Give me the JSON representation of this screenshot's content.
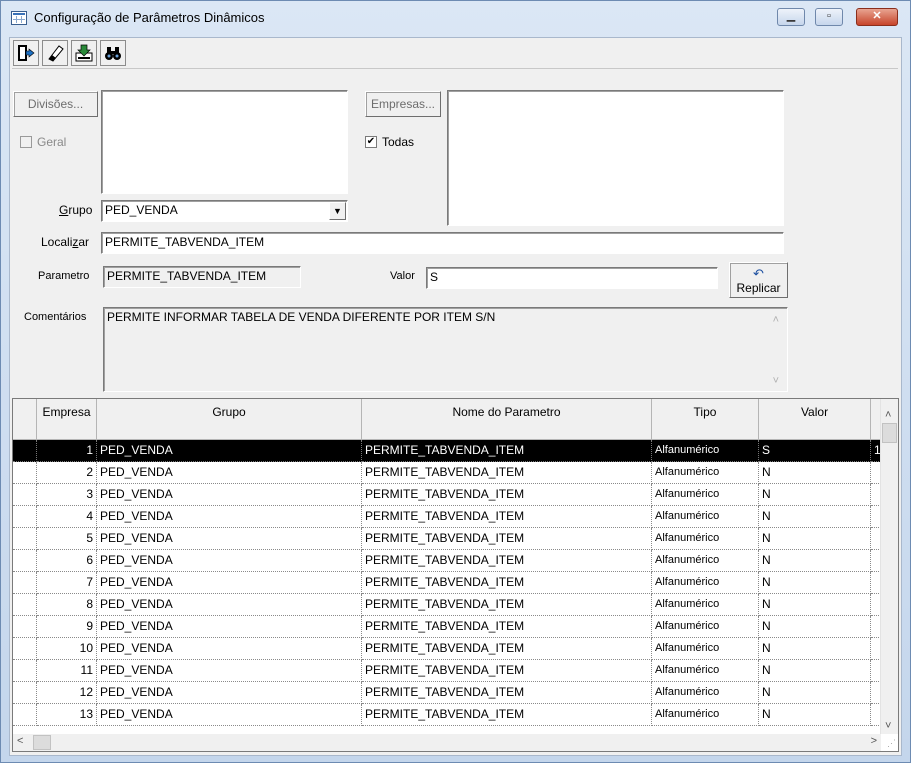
{
  "window": {
    "title": "Configuração de Parâmetros Dinâmicos"
  },
  "toolbar": {
    "buttons": [
      {
        "icon": "exit-door-icon"
      },
      {
        "icon": "eraser-icon"
      },
      {
        "icon": "save-download-icon"
      },
      {
        "icon": "binoculars-icon"
      }
    ]
  },
  "form": {
    "divisoes_label": "Divisões...",
    "geral_label": "Geral",
    "empresas_label": "Empresas...",
    "todas_label": "Todas",
    "todas_checked": "✔",
    "grupo_label": "Grupo",
    "grupo_value": "PED_VENDA",
    "localizar_label": "Localizar",
    "localizar_value": "PERMITE_TABVENDA_ITEM",
    "parametro_label": "Parametro",
    "parametro_value": "PERMITE_TABVENDA_ITEM",
    "valor_label": "Valor",
    "valor_value": "S",
    "replicar_label": "Replicar",
    "comentarios_label": "Comentários",
    "comentarios_value": "PERMITE INFORMAR TABELA DE VENDA DIFERENTE POR ITEM  S/N"
  },
  "grid": {
    "columns": [
      "Empresa",
      "Grupo",
      "Nome do Parametro",
      "Tipo",
      "Valor"
    ],
    "selected_row_extra": "1",
    "rows": [
      [
        "1",
        "PED_VENDA",
        "PERMITE_TABVENDA_ITEM",
        "Alfanumérico",
        "S"
      ],
      [
        "2",
        "PED_VENDA",
        "PERMITE_TABVENDA_ITEM",
        "Alfanumérico",
        "N"
      ],
      [
        "3",
        "PED_VENDA",
        "PERMITE_TABVENDA_ITEM",
        "Alfanumérico",
        "N"
      ],
      [
        "4",
        "PED_VENDA",
        "PERMITE_TABVENDA_ITEM",
        "Alfanumérico",
        "N"
      ],
      [
        "5",
        "PED_VENDA",
        "PERMITE_TABVENDA_ITEM",
        "Alfanumérico",
        "N"
      ],
      [
        "6",
        "PED_VENDA",
        "PERMITE_TABVENDA_ITEM",
        "Alfanumérico",
        "N"
      ],
      [
        "7",
        "PED_VENDA",
        "PERMITE_TABVENDA_ITEM",
        "Alfanumérico",
        "N"
      ],
      [
        "8",
        "PED_VENDA",
        "PERMITE_TABVENDA_ITEM",
        "Alfanumérico",
        "N"
      ],
      [
        "9",
        "PED_VENDA",
        "PERMITE_TABVENDA_ITEM",
        "Alfanumérico",
        "N"
      ],
      [
        "10",
        "PED_VENDA",
        "PERMITE_TABVENDA_ITEM",
        "Alfanumérico",
        "N"
      ],
      [
        "11",
        "PED_VENDA",
        "PERMITE_TABVENDA_ITEM",
        "Alfanumérico",
        "N"
      ],
      [
        "12",
        "PED_VENDA",
        "PERMITE_TABVENDA_ITEM",
        "Alfanumérico",
        "N"
      ],
      [
        "13",
        "PED_VENDA",
        "PERMITE_TABVENDA_ITEM",
        "Alfanumérico",
        "N"
      ]
    ]
  }
}
